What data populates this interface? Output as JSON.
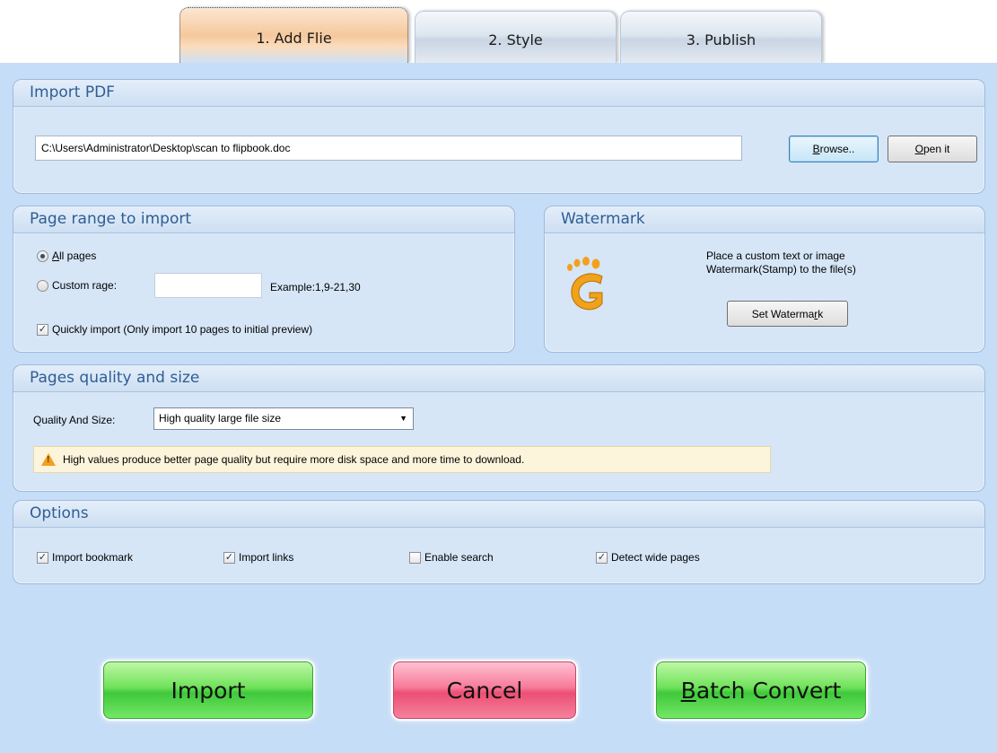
{
  "tabs": [
    {
      "label": "1. Add Flie"
    },
    {
      "label": "2. Style"
    },
    {
      "label": "3. Publish"
    }
  ],
  "import_pdf": {
    "title": "Import PDF",
    "path": "C:\\Users\\Administrator\\Desktop\\scan to flipbook.doc",
    "browse_pre": "",
    "browse_u": "B",
    "browse_post": "rowse..",
    "open_u": "O",
    "open_post": "pen it"
  },
  "page_range": {
    "title": "Page range to import",
    "all_pages_u": "A",
    "all_pages_post": "ll pages",
    "all_pages_selected": true,
    "custom_range_label": "Custom rage:",
    "custom_range_value": "",
    "example": "Example:1,9-21,30",
    "quick_import_label": "Quickly import (Only import 10 pages to  initial  preview)",
    "quick_import_checked": true
  },
  "watermark": {
    "title": "Watermark",
    "description_line1": "Place a custom text or image",
    "description_line2": "Watermark(Stamp) to the file(s)",
    "button_pre": "Set Waterma",
    "button_u": "r",
    "button_post": "k",
    "icon": "footprint-g-icon"
  },
  "quality": {
    "title": "Pages quality and size",
    "label": "Quality And Size:",
    "selected": "High quality large file size",
    "notice": "High values produce better page quality but require more disk space and more time to download."
  },
  "options": {
    "title": "Options",
    "items": [
      {
        "label": "Import bookmark",
        "checked": true
      },
      {
        "label": "Import links",
        "checked": true
      },
      {
        "label": "Enable search",
        "checked": false
      },
      {
        "label": "Detect wide pages",
        "checked": true
      }
    ]
  },
  "actions": {
    "import": "Import",
    "cancel": "Cancel",
    "batch_u": "B",
    "batch_post": "atch Convert"
  },
  "colors": {
    "background": "#c5ddf6",
    "panel_title": "#2e5d95",
    "import_button": "#5ed64c",
    "cancel_button": "#f0607f"
  }
}
